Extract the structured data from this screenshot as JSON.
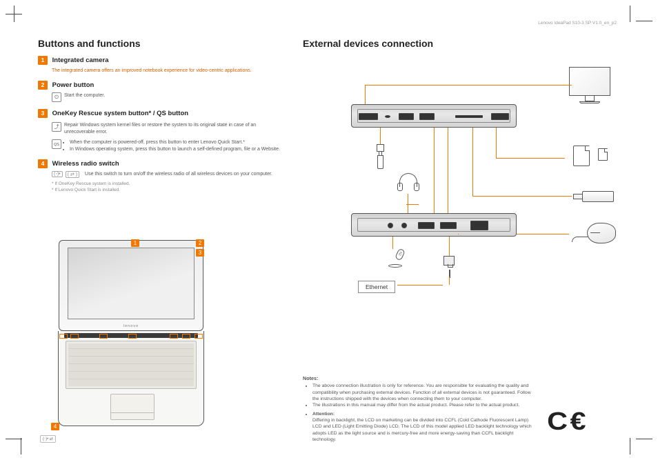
{
  "doc_header_path": "Lenovo IdeaPad S10-3 SP V1.0_en_p2",
  "left": {
    "heading": "Buttons and functions",
    "items": [
      {
        "num": "1",
        "title": "Integrated camera",
        "desc_orange": "The integrated camera offers an improved notebook experience for video-centric applications."
      },
      {
        "num": "2",
        "title": "Power button",
        "icon_glyph": "⏻",
        "icon_caption": "Start the computer."
      },
      {
        "num": "3",
        "title": "OneKey Rescue system button* / QS button",
        "icon_a_glyph": "⤴",
        "icon_a_caption": "Repair Windows system kernel files or restore the system to its original state in case of an unrecoverable error.",
        "icon_b_glyph": "QS",
        "bullets": [
          "When the computer is powered-off, press this button to enter Lenovo Quick Start.*",
          "In Windows operating system, press this button to launch a self-defined program, file or a Website."
        ]
      },
      {
        "num": "4",
        "title": "Wireless radio switch",
        "switch_glyph_left": "(◦)•",
        "switch_glyph_right": "( ⇄ )",
        "desc": "Use this switch to turn on/off the wireless radio of all wireless devices on your computer.",
        "footnote_a": "* If OneKey Rescue system is installed.",
        "footnote_b": "* If Lenovo Quick Start is installed."
      }
    ],
    "laptop_logo": "lenovo",
    "callouts": {
      "c1": "1",
      "c2": "2",
      "c3": "3",
      "c4": "4"
    }
  },
  "right": {
    "heading": "External devices connection",
    "ethernet_label": "Ethernet",
    "notes_heading": "Notes:",
    "notes": [
      "The above connection illustration is only for reference. You are responsible for evaluating the quality and compatibility when purchasing external devices. Function of all external devices is not guaranteed. Follow the instructions shipped with the devices when connecting them to your computer.",
      "The illustrations in this manual may differ from the actual product. Please refer to the actual product."
    ],
    "attention_heading": "Attention:",
    "attention": "Differing in backlight, the LCD on marketing can be divided into CCFL (Cold Cathode Fluorescent Lamp) LCD and LED (Light Emitting Diode) LCD. The LCD of this model applied LED backlight technology which adopts LED as the light source and is mercury-free and more energy-saving than CCFL backlight technology.",
    "ce_mark": "C€"
  }
}
